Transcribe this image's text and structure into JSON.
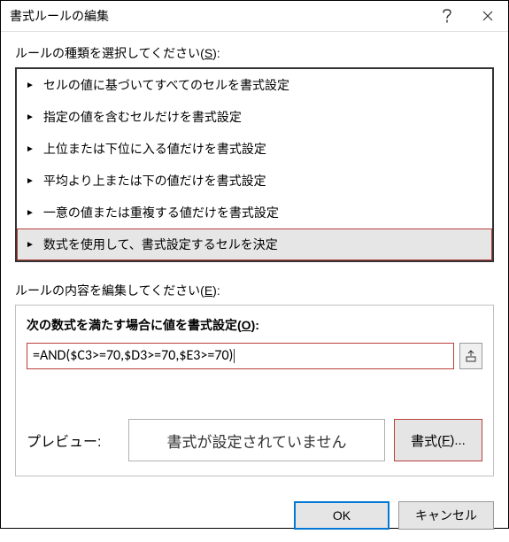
{
  "titlebar": {
    "title": "書式ルールの編集"
  },
  "ruleTypeSection": {
    "label_pre": "ルールの種類を選択してください(",
    "label_key": "S",
    "label_post": "):",
    "items": [
      "セルの値に基づいてすべてのセルを書式設定",
      "指定の値を含むセルだけを書式設定",
      "上位または下位に入る値だけを書式設定",
      "平均より上または下の値だけを書式設定",
      "一意の値または重複する値だけを書式設定",
      "数式を使用して、書式設定するセルを決定"
    ]
  },
  "ruleEditSection": {
    "label_pre": "ルールの内容を編集してください(",
    "label_key": "E",
    "label_post": "):",
    "formulaLabel_pre": "次の数式を満たす場合に値を書式設定(",
    "formulaLabel_key": "O",
    "formulaLabel_post": "):",
    "formulaValue": "=AND($C3>=70,$D3>=70,$E3>=70)",
    "previewLabel": "プレビュー:",
    "previewText": "書式が設定されていません",
    "formatButton_pre": "書式(",
    "formatButton_key": "F",
    "formatButton_post": ")..."
  },
  "footer": {
    "ok": "OK",
    "cancel": "キャンセル"
  }
}
